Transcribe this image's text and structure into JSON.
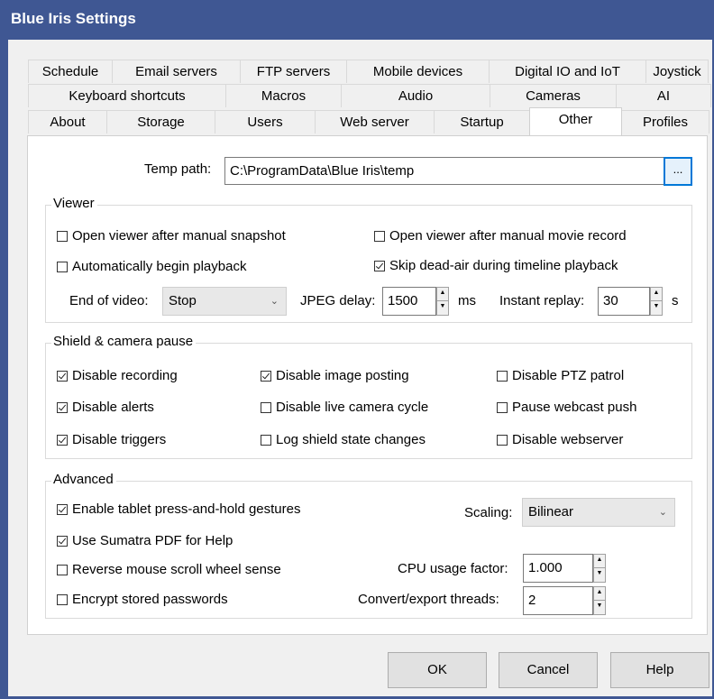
{
  "window": {
    "title": "Blue Iris Settings"
  },
  "tabs": {
    "row1": [
      "Schedule",
      "Email servers",
      "FTP servers",
      "Mobile devices",
      "Digital IO and IoT",
      "Joystick"
    ],
    "row2": [
      "Keyboard shortcuts",
      "Macros",
      "Audio",
      "Cameras",
      "AI"
    ],
    "row3": [
      "About",
      "Storage",
      "Users",
      "Web server",
      "Startup",
      "Other",
      "Profiles"
    ],
    "active": "Other"
  },
  "temp_path": {
    "label": "Temp path:",
    "value": "C:\\ProgramData\\Blue Iris\\temp",
    "browse_label": "..."
  },
  "viewer": {
    "title": "Viewer",
    "open_after_snapshot": {
      "label": "Open viewer after manual snapshot",
      "checked": false
    },
    "open_after_movie": {
      "label": "Open viewer after manual movie record",
      "checked": false
    },
    "auto_playback": {
      "label": "Automatically begin playback",
      "checked": false
    },
    "skip_dead_air": {
      "label": "Skip dead-air during timeline playback",
      "checked": true
    },
    "end_of_video": {
      "label": "End of video:",
      "value": "Stop"
    },
    "jpeg_delay": {
      "label": "JPEG delay:",
      "value": "1500",
      "unit": "ms"
    },
    "instant_replay": {
      "label": "Instant replay:",
      "value": "30",
      "unit": "s"
    }
  },
  "shield": {
    "title": "Shield & camera pause",
    "disable_recording": {
      "label": "Disable recording",
      "checked": true
    },
    "disable_image_posting": {
      "label": "Disable image posting",
      "checked": true
    },
    "disable_ptz_patrol": {
      "label": "Disable PTZ patrol",
      "checked": false
    },
    "disable_alerts": {
      "label": "Disable alerts",
      "checked": true
    },
    "disable_live_cycle": {
      "label": "Disable live camera cycle",
      "checked": false
    },
    "pause_webcast": {
      "label": "Pause webcast push",
      "checked": false
    },
    "disable_triggers": {
      "label": "Disable triggers",
      "checked": true
    },
    "log_shield_state": {
      "label": "Log shield state changes",
      "checked": false
    },
    "disable_webserver": {
      "label": "Disable webserver",
      "checked": false
    }
  },
  "advanced": {
    "title": "Advanced",
    "tablet_gestures": {
      "label": "Enable tablet press-and-hold gestures",
      "checked": true
    },
    "sumatra_pdf": {
      "label": "Use Sumatra PDF for Help",
      "checked": true
    },
    "reverse_scroll": {
      "label": "Reverse mouse scroll wheel sense",
      "checked": false
    },
    "encrypt_passwords": {
      "label": "Encrypt stored passwords",
      "checked": false
    },
    "scaling": {
      "label": "Scaling:",
      "value": "Bilinear"
    },
    "cpu_usage": {
      "label": "CPU usage factor:",
      "value": "1.000"
    },
    "export_threads": {
      "label": "Convert/export threads:",
      "value": "2"
    }
  },
  "buttons": {
    "ok": "OK",
    "cancel": "Cancel",
    "help": "Help"
  },
  "colors": {
    "titlebar": "#3f5793",
    "focus_border": "#0078d7"
  }
}
